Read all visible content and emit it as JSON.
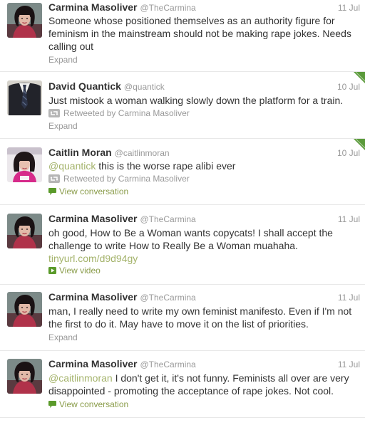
{
  "colors": {
    "name": "#333333",
    "muted": "#999999",
    "mention": "#a4b36b",
    "action": "#8a9c4a",
    "corner": "#5a9a3a",
    "divider": "#e8e8e8"
  },
  "icons": {
    "retweet": "retweet-icon",
    "conversation": "speech-bubble-icon",
    "video": "play-icon",
    "favorite_corner": "retweet-corner-ribbon-icon"
  },
  "tweets": [
    {
      "name": "Carmina Masoliver",
      "handle": "@TheCarmina",
      "time": "11 Jul",
      "text": "Someone whose positioned themselves as an authority figure for feminism in the mainstream should not be making rape jokes. Needs calling out",
      "expand": "Expand"
    },
    {
      "name": "David Quantick",
      "handle": "@quantick",
      "time": "10 Jul",
      "text": "Just mistook a woman walking slowly down the platform for a train.",
      "retweeted_by": "Retweeted by Carmina Masoliver",
      "expand": "Expand"
    },
    {
      "name": "Caitlin Moran",
      "handle": "@caitlinmoran",
      "time": "10 Jul",
      "mention": "@quantick",
      "text": " this is the worse rape alibi ever",
      "retweeted_by": "Retweeted by Carmina Masoliver",
      "view_conversation": "View conversation"
    },
    {
      "name": "Carmina Masoliver",
      "handle": "@TheCarmina",
      "time": "11 Jul",
      "text": "oh good, How to Be a Woman wants copycats! I shall accept the challenge to write How to Really Be a Woman muahaha.",
      "link": "tinyurl.com/d9d94gy",
      "view_video": "View video"
    },
    {
      "name": "Carmina Masoliver",
      "handle": "@TheCarmina",
      "time": "11 Jul",
      "text": "man, I really need to write my own feminist manifesto. Even if I'm not the first to do it. May have to move it on the list of priorities.",
      "expand": "Expand"
    },
    {
      "name": "Carmina Masoliver",
      "handle": "@TheCarmina",
      "time": "11 Jul",
      "mention": "@caitlinmoran",
      "text": " I don't get it, it's not funny. Feminists all over are very disappointed - promoting the acceptance of rape jokes. Not cool.",
      "view_conversation": "View conversation"
    }
  ]
}
